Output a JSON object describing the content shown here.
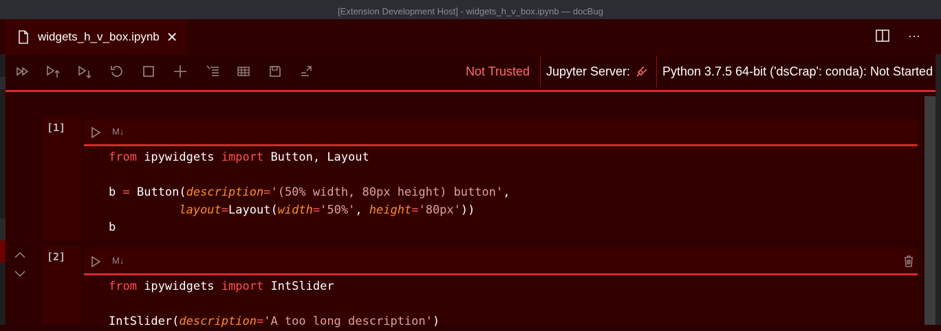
{
  "window": {
    "title": "[Extension Development Host] - widgets_h_v_box.ipynb — docBug"
  },
  "tab": {
    "label": "widgets_h_v_box.ipynb",
    "close": "✕"
  },
  "tab_actions": {
    "split": "split-editor-icon",
    "more": "···"
  },
  "toolbar": {
    "icons": [
      "run-all-icon",
      "run-above-icon",
      "run-below-icon",
      "restart-icon",
      "interrupt-icon",
      "add-cell-icon",
      "clear-outputs-icon",
      "variables-icon",
      "save-icon",
      "export-icon"
    ],
    "not_trusted": "Not Trusted",
    "jupyter_server": "Jupyter Server:",
    "kernel": "Python 3.7.5 64-bit ('dsCrap': conda): Not Started"
  },
  "cells": [
    {
      "count": "[1]",
      "md_label": "M↓",
      "lines": [
        [
          {
            "t": "from",
            "c": "kw"
          },
          {
            "t": " ipywidgets ",
            "c": ""
          },
          {
            "t": "import",
            "c": "kw"
          },
          {
            "t": " Button, Layout",
            "c": ""
          }
        ],
        [],
        [
          {
            "t": "b ",
            "c": ""
          },
          {
            "t": "=",
            "c": "op"
          },
          {
            "t": " Button(",
            "c": ""
          },
          {
            "t": "description",
            "c": "param"
          },
          {
            "t": "=",
            "c": "op"
          },
          {
            "t": "'(50% width, 80px height) button'",
            "c": "str"
          },
          {
            "t": ",",
            "c": ""
          }
        ],
        [
          {
            "t": "          ",
            "c": ""
          },
          {
            "t": "layout",
            "c": "param"
          },
          {
            "t": "=",
            "c": "op"
          },
          {
            "t": "Layout(",
            "c": ""
          },
          {
            "t": "width",
            "c": "param"
          },
          {
            "t": "=",
            "c": "op"
          },
          {
            "t": "'50%'",
            "c": "str"
          },
          {
            "t": ", ",
            "c": ""
          },
          {
            "t": "height",
            "c": "param"
          },
          {
            "t": "=",
            "c": "op"
          },
          {
            "t": "'80px'",
            "c": "str"
          },
          {
            "t": "))",
            "c": ""
          }
        ],
        [
          {
            "t": "b",
            "c": ""
          }
        ]
      ]
    },
    {
      "count": "[2]",
      "md_label": "M↓",
      "lines": [
        [
          {
            "t": "from",
            "c": "kw"
          },
          {
            "t": " ipywidgets ",
            "c": ""
          },
          {
            "t": "import",
            "c": "kw"
          },
          {
            "t": " IntSlider",
            "c": ""
          }
        ],
        [],
        [
          {
            "t": "IntSlider(",
            "c": ""
          },
          {
            "t": "description",
            "c": "param"
          },
          {
            "t": "=",
            "c": "op"
          },
          {
            "t": "'A too long description'",
            "c": "str"
          },
          {
            "t": ")",
            "c": ""
          }
        ]
      ]
    }
  ],
  "colors": {
    "accent": "#d92b2b",
    "background": "#2b0000",
    "warning_text": "#ff6b6b"
  }
}
